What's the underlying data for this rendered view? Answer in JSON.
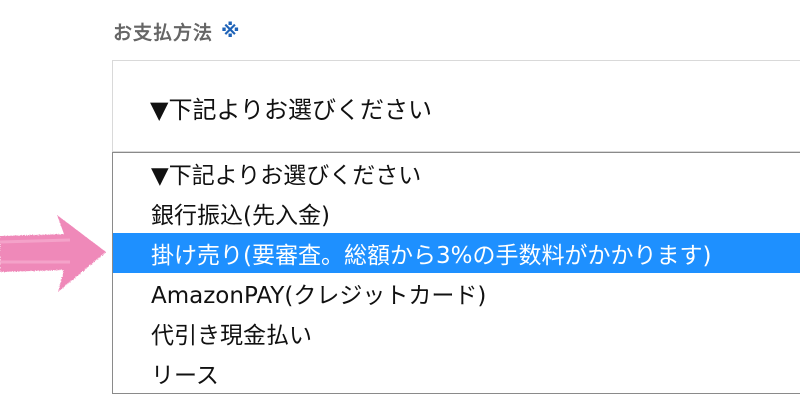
{
  "field": {
    "label": "お支払方法",
    "required_mark": "※"
  },
  "select": {
    "selected_value": "▼下記よりお選びください"
  },
  "options": [
    {
      "label": "▼下記よりお選びください",
      "highlighted": false
    },
    {
      "label": "銀行振込(先入金)",
      "highlighted": false
    },
    {
      "label": "掛け売り(要審査。総額から3%の手数料がかかります)",
      "highlighted": true
    },
    {
      "label": "AmazonPAY(クレジットカード)",
      "highlighted": false
    },
    {
      "label": "代引き現金払い",
      "highlighted": false
    },
    {
      "label": "リース",
      "highlighted": false
    }
  ],
  "icons": {
    "pointer_arrow": "arrow-right-icon"
  },
  "colors": {
    "highlight": "#1e90ff",
    "arrow": "#ee7fb4",
    "required_mark": "#1e63b8",
    "label": "#666666"
  }
}
